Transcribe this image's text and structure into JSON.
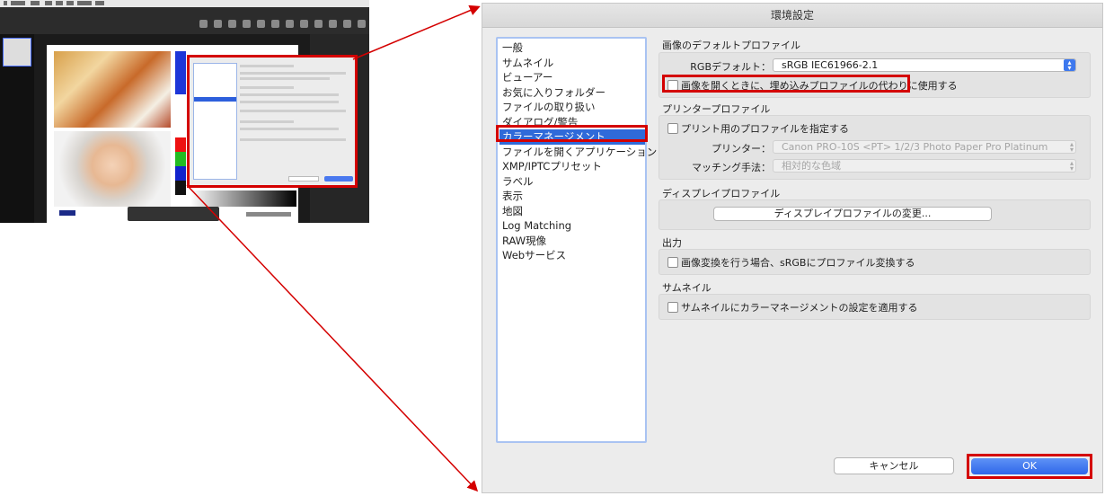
{
  "dialog": {
    "title": "環境設定"
  },
  "categories": [
    "一般",
    "サムネイル",
    "ビューアー",
    "お気に入りフォルダー",
    "ファイルの取り扱い",
    "ダイアログ/警告",
    "カラーマネージメント",
    "ファイルを開くアプリケーション",
    "XMP/IPTCプリセット",
    "ラベル",
    "表示",
    "地図",
    "Log Matching",
    "RAW現像",
    "Webサービス"
  ],
  "selected_category": "カラーマネージメント",
  "default_profile": {
    "title": "画像のデフォルトプロファイル",
    "rgb_label": "RGBデフォルト：",
    "rgb_value": "sRGB IEC61966-2.1",
    "embedded_checkbox": "画像を開くときに、埋め込みプロファイルの代わりに使用する"
  },
  "printer_profile": {
    "title": "プリンタープロファイル",
    "specify_checkbox": "プリント用のプロファイルを指定する",
    "printer_label": "プリンター：",
    "printer_value": "Canon PRO-10S <PT> 1/2/3 Photo Paper Pro Platinum",
    "matching_label": "マッチング手法：",
    "matching_value": "相対的な色域"
  },
  "display_profile": {
    "title": "ディスプレイプロファイル",
    "change_button": "ディスプレイプロファイルの変更..."
  },
  "output": {
    "title": "出力",
    "convert_checkbox": "画像変換を行う場合、sRGBにプロファイル変換する"
  },
  "thumbnail": {
    "title": "サムネイル",
    "apply_checkbox": "サムネイルにカラーマネージメントの設定を適用する"
  },
  "buttons": {
    "cancel": "キャンセル",
    "ok": "OK"
  },
  "colors": {
    "highlight": "#d40000",
    "selection": "#2f6ad9",
    "accent_button": "#3d78ee"
  }
}
